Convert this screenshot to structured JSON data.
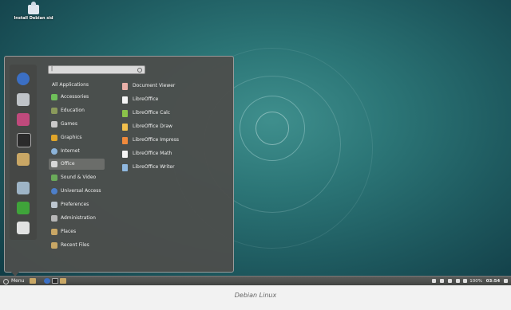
{
  "desktop": {
    "icon_label": "Install Debian sid"
  },
  "menu": {
    "search": {
      "value": "|"
    },
    "all_applications": "All Applications",
    "categories": [
      "Accessories",
      "Education",
      "Games",
      "Graphics",
      "Internet",
      "Office",
      "Sound & Video",
      "Universal Access",
      "Preferences",
      "Administration",
      "Places",
      "Recent Files"
    ],
    "selected_category": "Office",
    "apps": [
      "Document Viewer",
      "LibreOffice",
      "LibreOffice Calc",
      "LibreOffice Draw",
      "LibreOffice Impress",
      "LibreOffice Math",
      "LibreOffice Writer"
    ],
    "favorites": [
      "web-browser-icon",
      "settings-icon",
      "software-icon",
      "terminal-icon",
      "files-icon",
      "display-icon",
      "logout-icon",
      "lock-icon"
    ]
  },
  "panel": {
    "menu_label": "Menu",
    "battery": "100%",
    "clock": "03:54"
  },
  "caption": "Debian Linux",
  "colors": {
    "accent": "#2c7677",
    "menu_bg": "#4c4e4c",
    "panel": "#4a4c4a"
  }
}
